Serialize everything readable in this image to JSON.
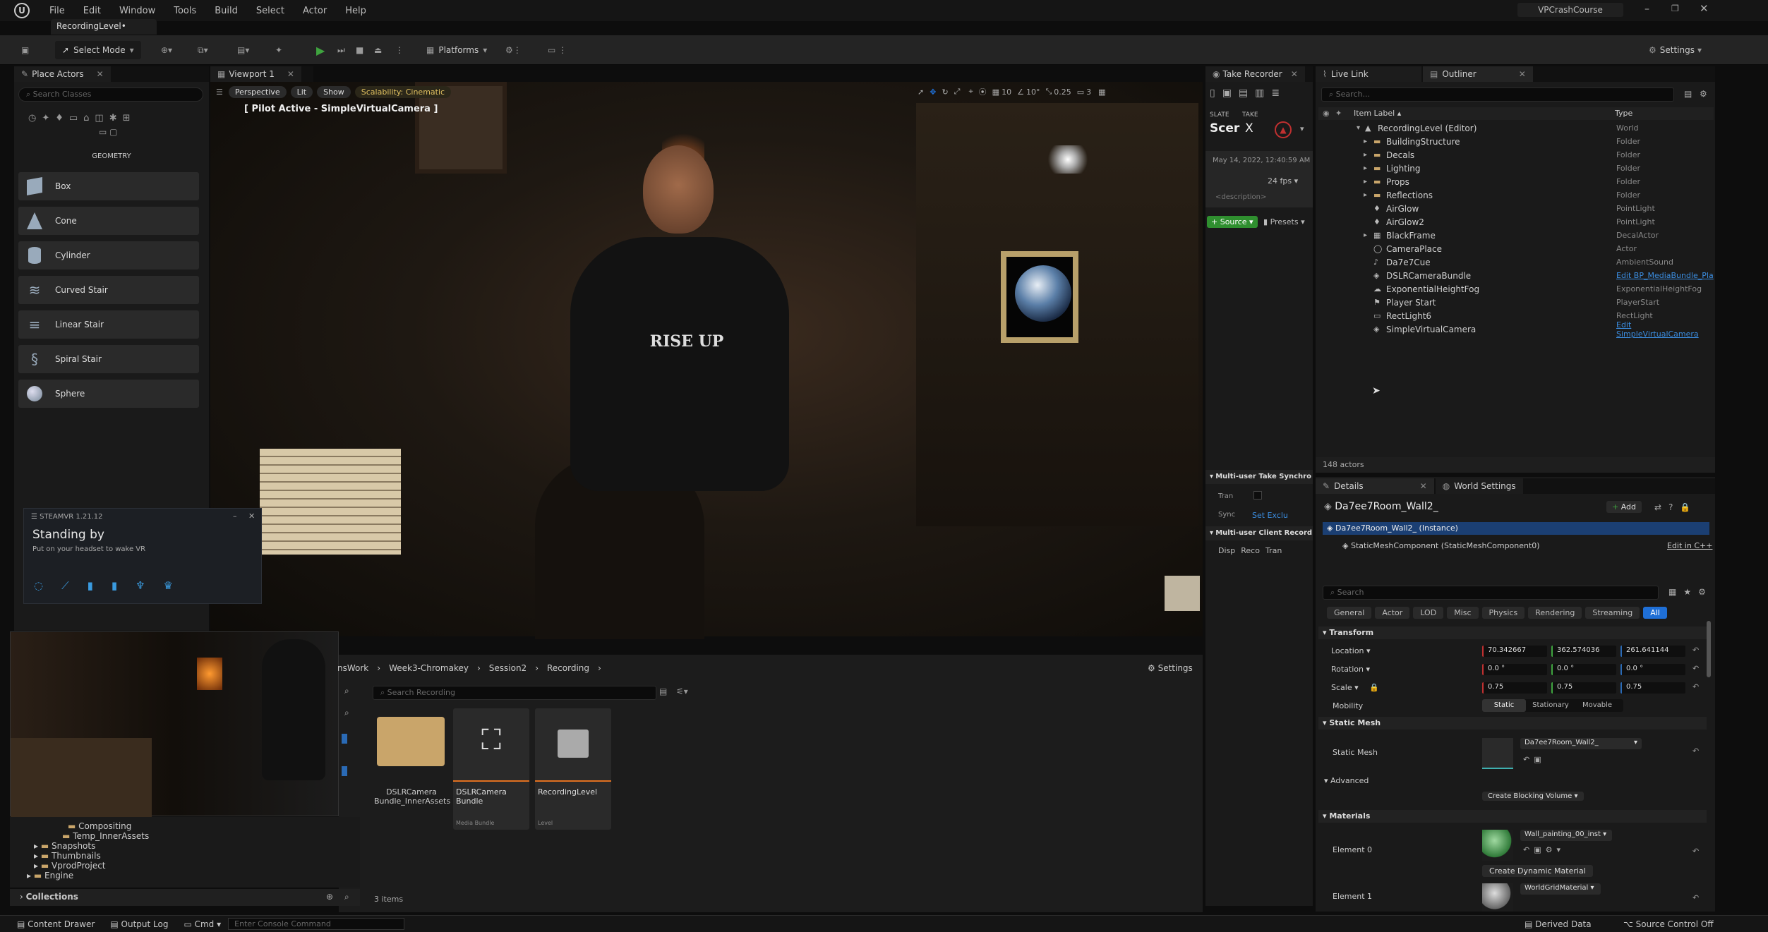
{
  "window": {
    "project": "VPCrashCourse",
    "doc_tab": "RecordingLevel•"
  },
  "menu": [
    "File",
    "Edit",
    "Window",
    "Tools",
    "Build",
    "Select",
    "Actor",
    "Help"
  ],
  "toolbar": {
    "select_mode": "Select Mode",
    "platforms": "Platforms",
    "settings": "Settings"
  },
  "place_actors": {
    "tab": "Place Actors",
    "search_placeholder": "Search Classes",
    "section": "GEOMETRY",
    "items": [
      "Box",
      "Cone",
      "Cylinder",
      "Curved Stair",
      "Linear Stair",
      "Spiral Stair",
      "Sphere"
    ]
  },
  "viewport": {
    "tab": "Viewport 1",
    "perspective": "Perspective",
    "lit": "Lit",
    "show": "Show",
    "scalability": "Scalability: Cinematic",
    "pilot": "[ Pilot Active - SimpleVirtualCamera ]",
    "grid": "10",
    "angle": "10°",
    "speed": "0.25",
    "cams": "3"
  },
  "steamvr": {
    "title": "STEAMVR 1.21.12",
    "status": "Standing by",
    "hint": "Put on your headset to wake VR"
  },
  "take_recorder": {
    "tab": "Take Recorder",
    "slate_label": "SLATE",
    "take_label": "TAKE",
    "slate_value": "Scer",
    "take_value": "X",
    "date": "May 14, 2022, 12:40:59 AM",
    "fps": "24 fps",
    "description": "<description>",
    "source": "Source",
    "presets": "Presets",
    "multi_user_sync": "Multi-user Take Synchro",
    "tran": "Tran",
    "sync": "Sync",
    "set_exclu": "Set Exclu",
    "client_record": "Multi-user Client Record",
    "buttons": [
      "Disp",
      "Reco",
      "Tran"
    ]
  },
  "live_link": {
    "tab": "Live Link"
  },
  "outliner": {
    "tab": "Outliner",
    "search_placeholder": "Search...",
    "col_label": "Item Label",
    "col_type": "Type",
    "count": "148 actors",
    "rows": [
      {
        "label": "RecordingLevel (Editor)",
        "type": "World",
        "indent": 0
      },
      {
        "label": "BuildingStructure",
        "type": "Folder",
        "indent": 1
      },
      {
        "label": "Decals",
        "type": "Folder",
        "indent": 1
      },
      {
        "label": "Lighting",
        "type": "Folder",
        "indent": 1
      },
      {
        "label": "Props",
        "type": "Folder",
        "indent": 1
      },
      {
        "label": "Reflections",
        "type": "Folder",
        "indent": 1
      },
      {
        "label": "AirGlow",
        "type": "PointLight",
        "indent": 1
      },
      {
        "label": "AirGlow2",
        "type": "PointLight",
        "indent": 1
      },
      {
        "label": "BlackFrame",
        "type": "DecalActor",
        "indent": 1
      },
      {
        "label": "CameraPlace",
        "type": "Actor",
        "indent": 1
      },
      {
        "label": "Da7e7Cue",
        "type": "AmbientSound",
        "indent": 1
      },
      {
        "label": "DSLRCameraBundle",
        "type": "Edit BP_MediaBundle_Pla",
        "indent": 1
      },
      {
        "label": "ExponentialHeightFog",
        "type": "ExponentialHeightFog",
        "indent": 1
      },
      {
        "label": "Player Start",
        "type": "PlayerStart",
        "indent": 1
      },
      {
        "label": "RectLight6",
        "type": "RectLight",
        "indent": 1
      },
      {
        "label": "SimpleVirtualCamera",
        "type": "Edit SimpleVirtualCamera",
        "indent": 1
      }
    ]
  },
  "details": {
    "tab": "Details",
    "world_settings": "World Settings",
    "object": "Da7ee7Room_Wall2_",
    "add": "Add",
    "instance": "Da7ee7Room_Wall2_ (Instance)",
    "component": "StaticMeshComponent (StaticMeshComponent0)",
    "edit_cpp": "Edit in C++",
    "search_placeholder": "Search",
    "filters": [
      "General",
      "Actor",
      "LOD",
      "Misc",
      "Physics",
      "Rendering",
      "Streaming",
      "All"
    ],
    "transform": "Transform",
    "location": "Location",
    "rotation": "Rotation",
    "scale": "Scale",
    "loc": [
      "70.342667",
      "362.574036",
      "261.641144"
    ],
    "rot": [
      "0.0 °",
      "0.0 °",
      "0.0 °"
    ],
    "scl": [
      "0.75",
      "0.75",
      "0.75"
    ],
    "mobility": "Mobility",
    "mob_opts": [
      "Static",
      "Stationary",
      "Movable"
    ],
    "static_mesh_section": "Static Mesh",
    "static_mesh_label": "Static Mesh",
    "static_mesh_value": "Da7ee7Room_Wall2_",
    "advanced": "Advanced",
    "blocking": "Create Blocking Volume",
    "materials": "Materials",
    "element0": "Element 0",
    "element0_mat": "Wall_painting_00_inst",
    "create_dynamic": "Create Dynamic Material",
    "element1": "Element 1",
    "element1_mat": "WorldGridMaterial"
  },
  "content": {
    "breadcrumb": [
      "nsWork",
      "Week3-Chromakey",
      "Session2",
      "Recording"
    ],
    "settings": "Settings",
    "search_placeholder": "Search Recording",
    "assets": [
      {
        "name": "DSLRCamera Bundle_InnerAssets",
        "sub": ""
      },
      {
        "name": "DSLRCamera Bundle",
        "sub": "Media Bundle"
      },
      {
        "name": "RecordingLevel",
        "sub": "Level"
      }
    ],
    "count": "3 items",
    "tree": [
      "Compositing",
      "Temp_InnerAssets",
      "Snapshots",
      "Thumbnails",
      "VprodProject",
      "Engine"
    ],
    "collections": "Collections"
  },
  "status": {
    "content_drawer": "Content Drawer",
    "output_log": "Output Log",
    "cmd": "Cmd",
    "console_placeholder": "Enter Console Command",
    "derived": "Derived Data",
    "source_control": "Source Control Off"
  },
  "colors": {
    "accent": "#1f6fd6",
    "play": "#3fa43f",
    "link": "#3b8de0",
    "selection": "#1b3f73"
  }
}
